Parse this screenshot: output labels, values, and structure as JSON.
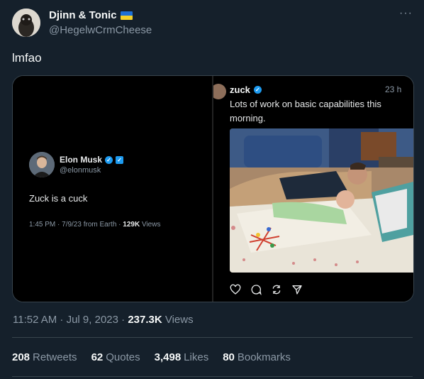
{
  "author": {
    "display_name": "Djinn & Tonic",
    "handle": "@HegelwCrmCheese",
    "flag_icon": "ukraine-flag-icon"
  },
  "more_label": "···",
  "tweet_text": "lmfao",
  "embedded_left": {
    "name": "Elon Musk",
    "handle": "@elonmusk",
    "text": "Zuck is a cuck",
    "meta_prefix": "1:45 PM · 7/9/23 from Earth · ",
    "views_count": "129K",
    "views_label": " Views"
  },
  "embedded_right": {
    "name": "zuck",
    "time": "23 h",
    "text": "Lots of work on basic capabilities this morning."
  },
  "timestamp": {
    "prefix": "11:52 AM · Jul 9, 2023 · ",
    "views_count": "237.3K",
    "views_label": " Views"
  },
  "stats": [
    {
      "count": "208",
      "label": "Retweets"
    },
    {
      "count": "62",
      "label": "Quotes"
    },
    {
      "count": "3,498",
      "label": "Likes"
    },
    {
      "count": "80",
      "label": "Bookmarks"
    }
  ],
  "colors": {
    "background": "#15202b",
    "accent": "#1d9bf0",
    "muted_text": "#8b98a5",
    "border": "#38444d"
  }
}
